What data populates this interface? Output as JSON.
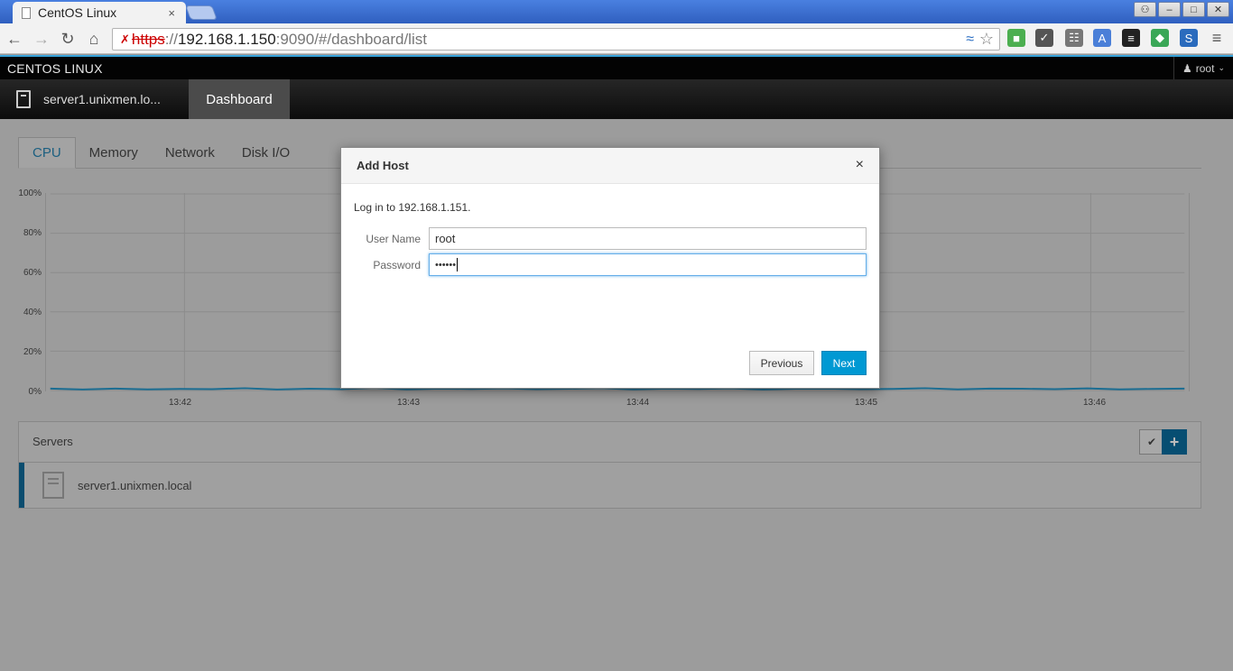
{
  "browser": {
    "tab_title": "CentOS Linux",
    "tab_close": "×",
    "url_scheme": "https",
    "url_host": "192.168.1.150",
    "url_path": ":9090/#/dashboard/list",
    "window_buttons": [
      "user",
      "–",
      "□",
      "✕"
    ]
  },
  "app": {
    "brand": "CENTOS LINUX",
    "user": "root",
    "server_tab": "server1.unixmen.lo...",
    "dashboard_tab": "Dashboard"
  },
  "subtabs": [
    "CPU",
    "Memory",
    "Network",
    "Disk I/O"
  ],
  "chart_data": {
    "type": "line",
    "y_ticks": [
      "100%",
      "80%",
      "60%",
      "40%",
      "20%",
      "0%"
    ],
    "x_ticks": [
      "13:42",
      "13:43",
      "13:44",
      "13:45",
      "13:46"
    ],
    "ylim": [
      0,
      100
    ],
    "series": [
      {
        "values": [
          1,
          0.5,
          1,
          0.6,
          0.8,
          0.7,
          1.2,
          0.5,
          0.9,
          0.7,
          1.3,
          0.6,
          1.0,
          0.8,
          1.1,
          0.7,
          0.9,
          1.2,
          0.6,
          1.0,
          0.8,
          1.1,
          0.5,
          0.9,
          1.0,
          0.7,
          0.8,
          1.2,
          0.6,
          1.0,
          0.9,
          0.7,
          1.1,
          0.6,
          0.8,
          1.0
        ]
      }
    ],
    "color": "#1b6d92"
  },
  "servers": {
    "title": "Servers",
    "items": [
      {
        "name": "server1.unixmen.local"
      }
    ]
  },
  "modal": {
    "title": "Add Host",
    "close": "×",
    "message": "Log in to 192.168.1.151.",
    "user_label": "User Name",
    "user_value": "root",
    "password_label": "Password",
    "password_value": "••••••",
    "previous_label": "Previous",
    "next_label": "Next"
  }
}
